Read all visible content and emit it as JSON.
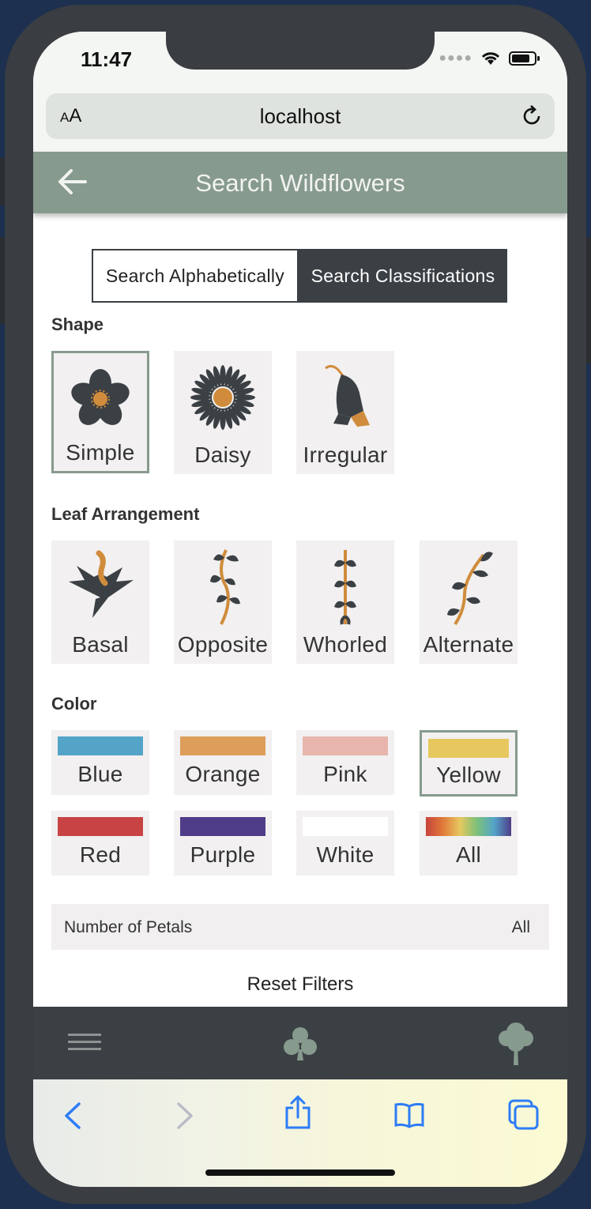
{
  "status": {
    "time": "11:47"
  },
  "browser": {
    "aa_small": "A",
    "aa_large": "A",
    "url": "localhost"
  },
  "header": {
    "title": "Search Wildflowers"
  },
  "segments": {
    "alphabetical": "Search Alphabetically",
    "classifications": "Search Classifications"
  },
  "sections": {
    "shape": "Shape",
    "leaf": "Leaf Arrangement",
    "color": "Color"
  },
  "shapes": [
    {
      "label": "Simple",
      "selected": true
    },
    {
      "label": "Daisy",
      "selected": false
    },
    {
      "label": "Irregular",
      "selected": false
    }
  ],
  "leaves": [
    {
      "label": "Basal"
    },
    {
      "label": "Opposite"
    },
    {
      "label": "Whorled"
    },
    {
      "label": "Alternate"
    }
  ],
  "colors": [
    {
      "label": "Blue",
      "swatch": "#54a4c8",
      "selected": false
    },
    {
      "label": "Orange",
      "swatch": "#dc9e5a",
      "selected": false
    },
    {
      "label": "Pink",
      "swatch": "#e7b5ac",
      "selected": false
    },
    {
      "label": "Yellow",
      "swatch": "#e6c85e",
      "selected": true
    },
    {
      "label": "Red",
      "swatch": "#c84444",
      "selected": false
    },
    {
      "label": "Purple",
      "swatch": "#4f3d89",
      "selected": false
    },
    {
      "label": "White",
      "swatch": "#ffffff",
      "selected": false
    },
    {
      "label": "All",
      "swatch": "rainbow",
      "selected": false
    }
  ],
  "petals": {
    "label": "Number of Petals",
    "value": "All"
  },
  "reset_label": "Reset Filters",
  "theme": {
    "header": "#879a8e",
    "dark": "#3b4044",
    "accent": "#d08c3c",
    "icon": "#3b4044",
    "safari_blue": "#2d7cf6"
  },
  "icons": {
    "back": "arrow-left-icon",
    "reload": "reload-icon",
    "menu": "menu-icon",
    "flower": "flower-icon",
    "tree": "tree-icon",
    "share": "share-icon",
    "bookmarks": "book-icon",
    "tabs": "tabs-icon"
  }
}
